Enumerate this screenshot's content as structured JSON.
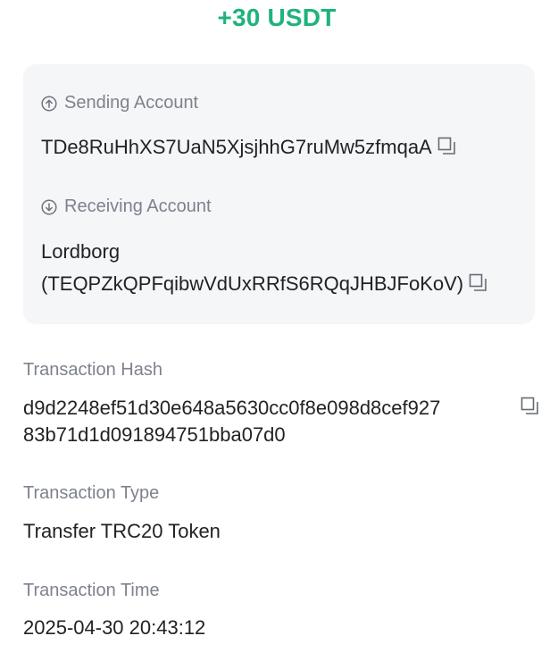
{
  "amount": "+30 USDT",
  "sending": {
    "label": "Sending Account",
    "address": "TDe8RuHhXS7UaN5XjsjhhG7ruMw5zfmqaA"
  },
  "receiving": {
    "label": "Receiving Account",
    "name": "Lordborg",
    "address": "(TEQPZkQPFqibwVdUxRRfS6RQqJHBJFoKoV)"
  },
  "hash": {
    "label": "Transaction Hash",
    "line1": "d9d2248ef51d30e648a5630cc0f8e098d8cef927",
    "line2": "83b71d1d091894751bba07d0"
  },
  "type": {
    "label": "Transaction Type",
    "value": "Transfer TRC20 Token"
  },
  "time": {
    "label": "Transaction Time",
    "value": "2025-04-30 20:43:12"
  },
  "colors": {
    "accent": "#1fb37c",
    "label": "#7d828c",
    "card": "#f5f6f8"
  },
  "icons": [
    "arrow-up-circle-icon",
    "arrow-down-circle-icon",
    "copy-icon"
  ]
}
